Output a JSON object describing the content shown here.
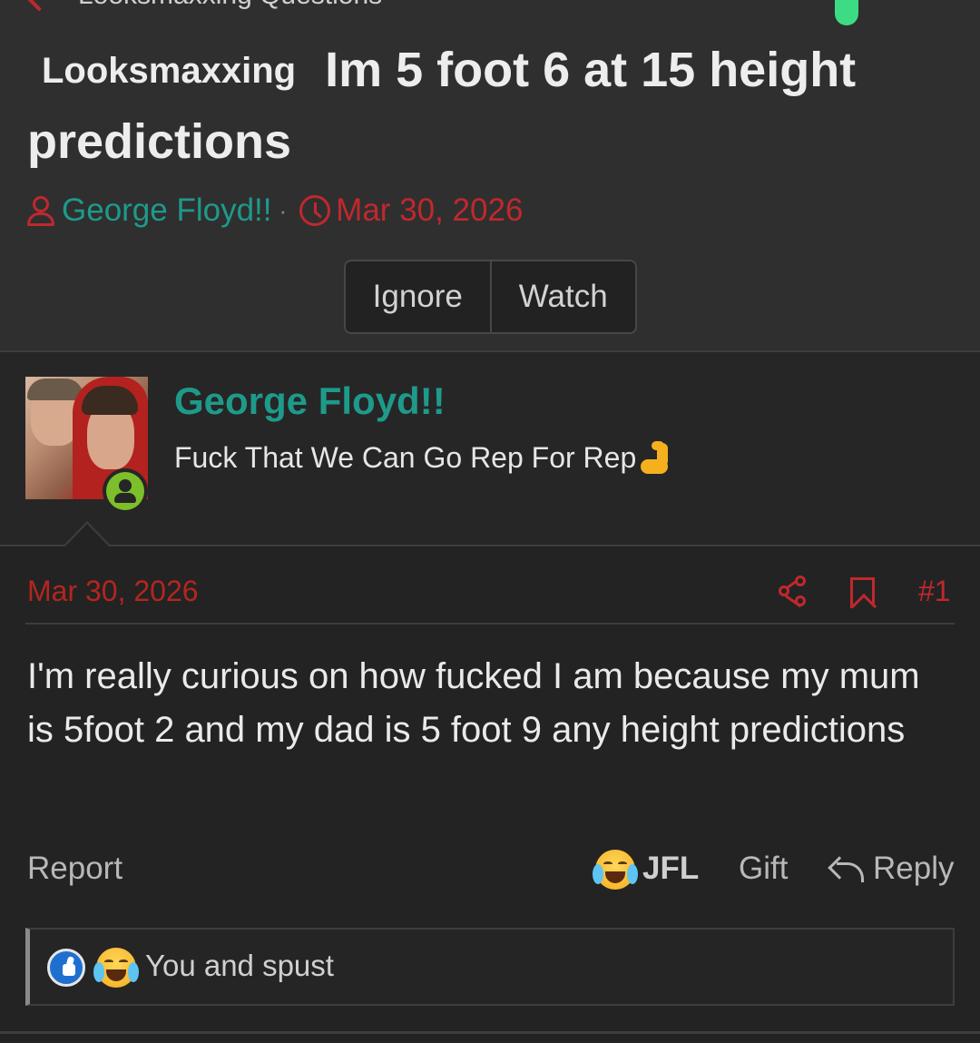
{
  "breadcrumb": {
    "label": "Looksmaxxing Questions"
  },
  "thread": {
    "prefix": "Looksmaxxing",
    "title": "Im 5 foot 6 at 15 height predictions",
    "author": "George Floyd!!",
    "separator": "·",
    "date": "Mar 30, 2026"
  },
  "actions": {
    "ignore": "Ignore",
    "watch": "Watch"
  },
  "user": {
    "name": "George Floyd!!",
    "title": "Fuck That We Can Go Rep For Rep"
  },
  "post": {
    "date": "Mar 30, 2026",
    "number": "#1",
    "body": "I'm really curious on how fucked I am because my mum is 5foot 2 and my dad is 5 foot 9 any height predictions"
  },
  "footer": {
    "report": "Report",
    "jfl": "JFL",
    "gift": "Gift",
    "reply": "Reply"
  },
  "reactions": {
    "text": "You and spust"
  },
  "colors": {
    "accent_red": "#c0282d",
    "username_teal": "#1e9a8b",
    "online_green": "#7cbf2a",
    "like_blue": "#1f6fd1"
  },
  "icons": [
    "back-arrow-icon",
    "user-icon",
    "clock-icon",
    "online-status-icon",
    "share-icon",
    "bookmark-icon",
    "laughing-crying-emoji-icon",
    "reply-icon",
    "like-icon",
    "flexed-biceps-emoji-icon"
  ]
}
